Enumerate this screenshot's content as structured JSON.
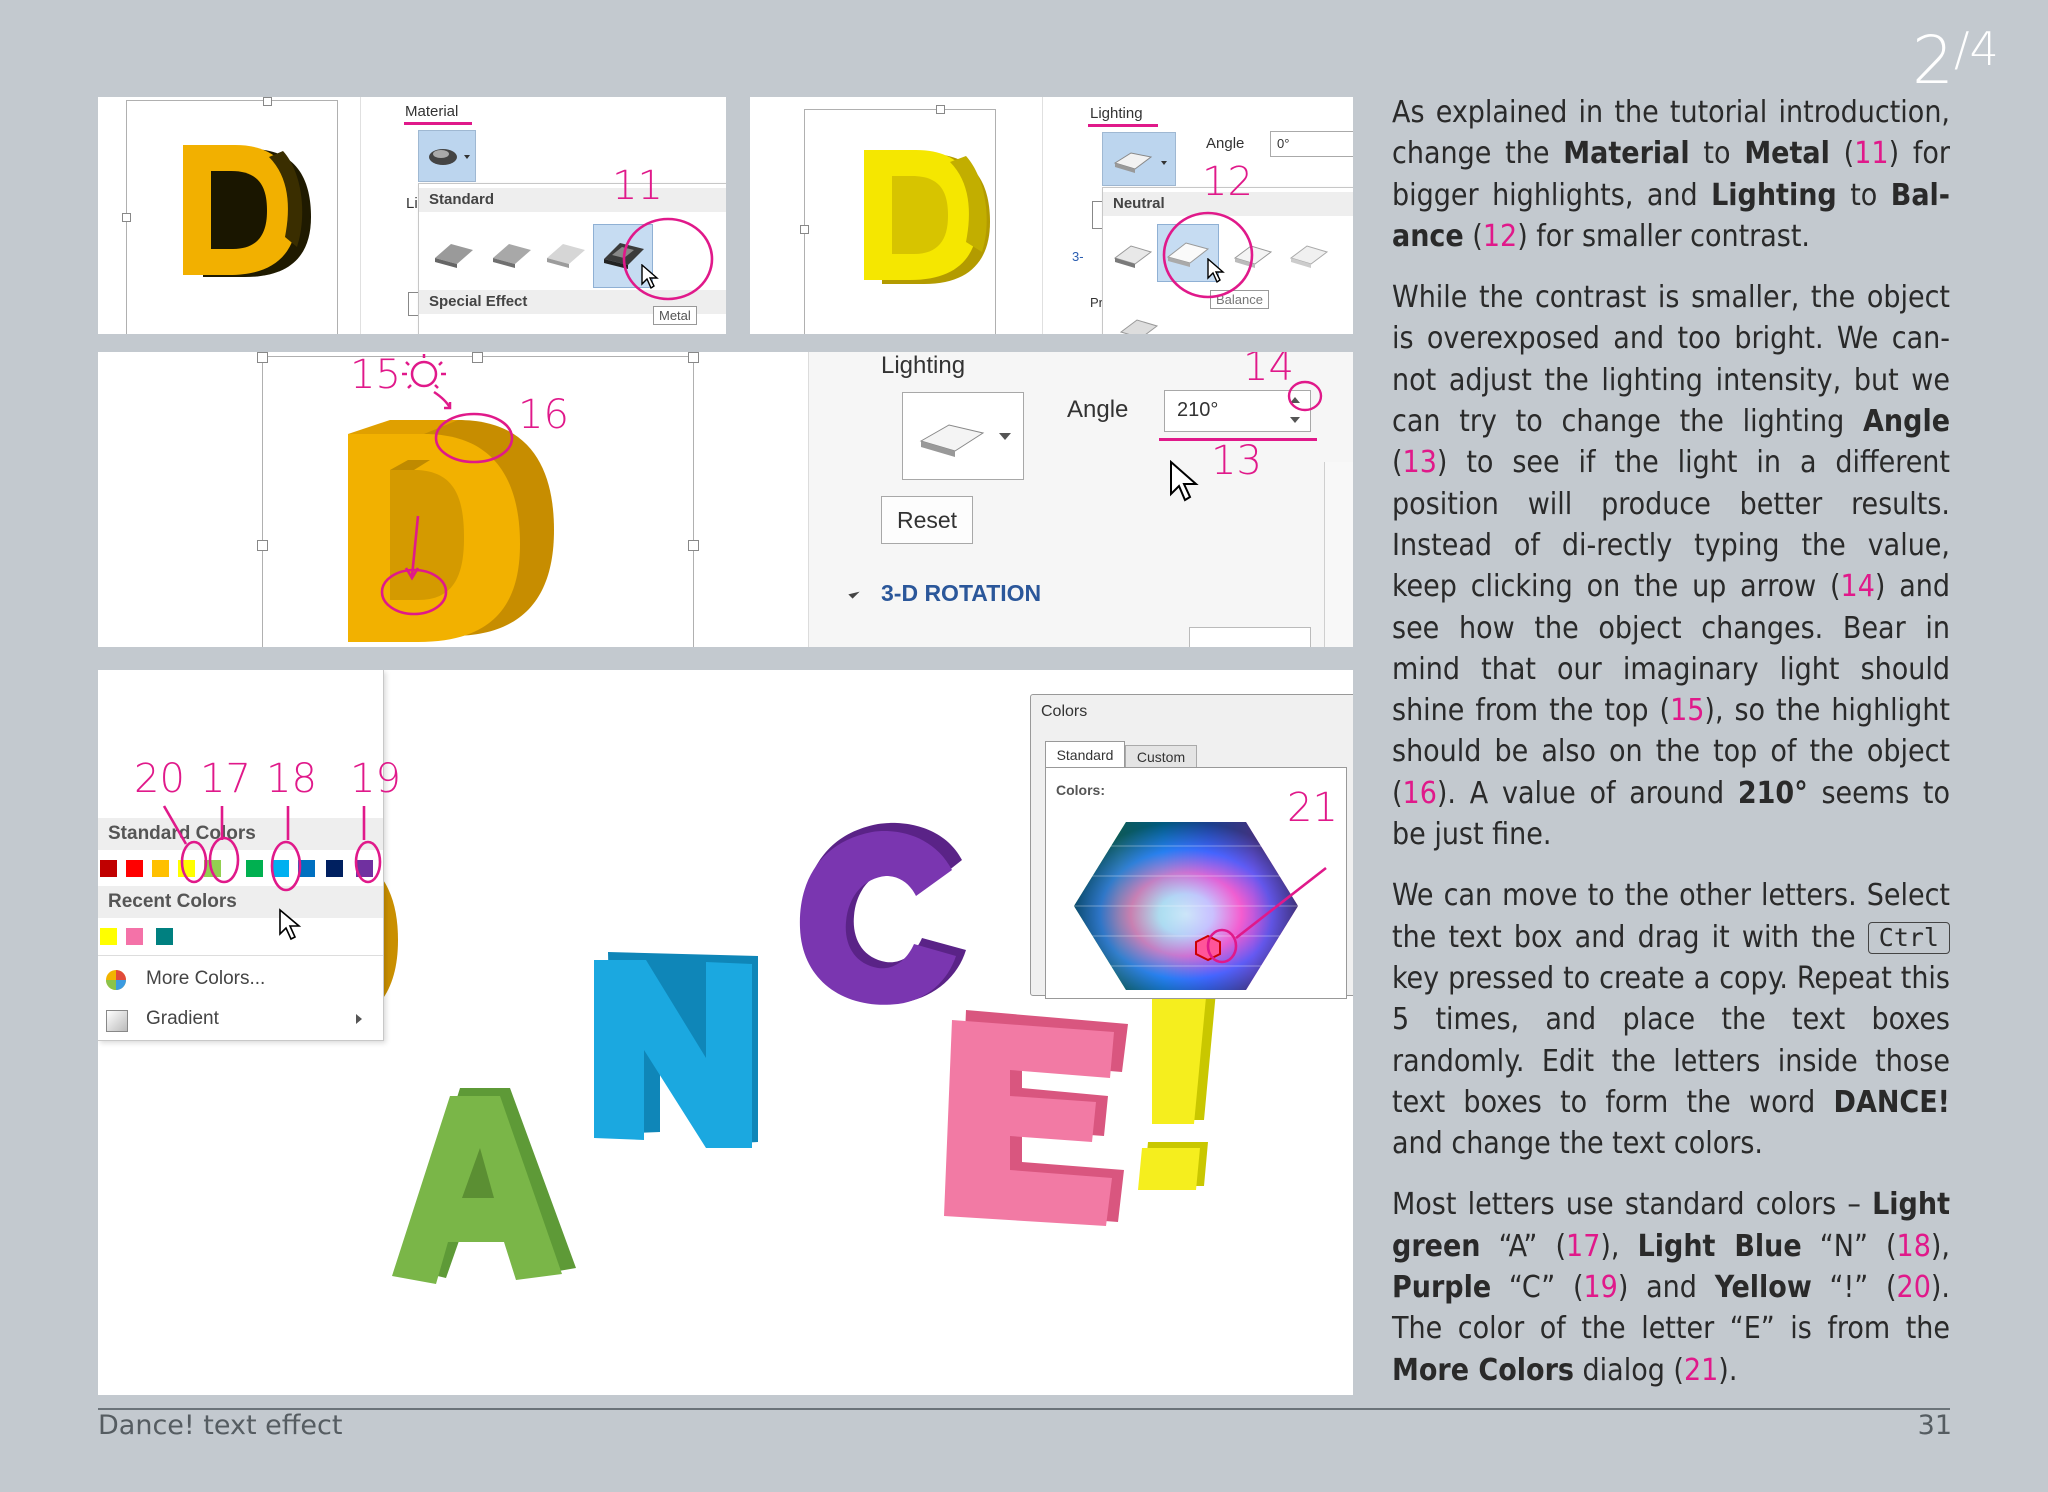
{
  "page_badge": {
    "current": "2",
    "total": "4"
  },
  "top_left": {
    "material_label": "Material",
    "lighting_abbrev": "Li",
    "standard_header": "Standard",
    "special_header": "Special Effect",
    "tooltip": "Metal",
    "callout": "11"
  },
  "top_right": {
    "lighting_label": "Lighting",
    "angle_label": "Angle",
    "angle_value": "0°",
    "neutral_header": "Neutral",
    "tooltip": "Balance",
    "callout": "12",
    "cut_3": "3-",
    "cut_pr": "Pr"
  },
  "middle": {
    "lighting_label": "Lighting",
    "angle_label": "Angle",
    "angle_value": "210°",
    "reset_label": "Reset",
    "rotation_label": "3-D ROTATION",
    "callout_13": "13",
    "callout_14": "14",
    "callout_15": "15",
    "callout_16": "16"
  },
  "bottom": {
    "standard_colors_label": "Standard Colors",
    "recent_colors_label": "Recent Colors",
    "more_colors_label": "More Colors...",
    "gradient_label": "Gradient",
    "dialog_title": "Colors",
    "tab_standard": "Standard",
    "tab_custom": "Custom",
    "colors_label": "Colors:",
    "standard_colors": [
      "#c00000",
      "#ff0000",
      "#ffc000",
      "#ffff00",
      "#92d050",
      "#00b050",
      "#00b0f0",
      "#0070c0",
      "#002060",
      "#7030a0"
    ],
    "recent_colors": [
      "#ffff00",
      "#f472a8",
      "#008080"
    ],
    "callout_17": "17",
    "callout_18": "18",
    "callout_19": "19",
    "callout_20": "20",
    "callout_21": "21",
    "letter_colors": {
      "D": "#f0b400",
      "A": "#74b547",
      "N": "#17a5df",
      "C": "#7030a0",
      "E": "#f07099",
      "!": "#f4ec1c"
    }
  },
  "text": {
    "p1": [
      {
        "t": "As explained in the tutorial introduction, change the "
      },
      {
        "t": "Material",
        "b": true
      },
      {
        "t": " to "
      },
      {
        "t": "Metal",
        "b": true
      },
      {
        "t": " ("
      },
      {
        "t": "11",
        "n": true
      },
      {
        "t": ") for bigger highlights, and "
      },
      {
        "t": "Lighting",
        "b": true
      },
      {
        "t": " to "
      },
      {
        "t": "Bal-ance",
        "b": true
      },
      {
        "t": " ("
      },
      {
        "t": "12",
        "n": true
      },
      {
        "t": ") for smaller contrast."
      }
    ],
    "p2": [
      {
        "t": "While the contrast is smaller, the object is overexposed and too bright. We can-not adjust the lighting intensity, but we can try to change the lighting "
      },
      {
        "t": "Angle",
        "b": true
      },
      {
        "t": " ("
      },
      {
        "t": "13",
        "n": true
      },
      {
        "t": ") to see if the light in a different position will produce better results. Instead of di-rectly typing the value, keep clicking on the up arrow ("
      },
      {
        "t": "14",
        "n": true
      },
      {
        "t": ") and see how the object changes. Bear in mind that our imaginary light should shine from the top ("
      },
      {
        "t": "15",
        "n": true
      },
      {
        "t": "), so the highlight should be also on the top of the object ("
      },
      {
        "t": "16",
        "n": true
      },
      {
        "t": "). A value of around "
      },
      {
        "t": "210°",
        "b": true
      },
      {
        "t": " seems to be just fine."
      }
    ],
    "p3": [
      {
        "t": "We can move to the other letters. Select the text box and drag it with the "
      },
      {
        "t": "Ctrl",
        "k": true
      },
      {
        "t": " key pressed to create a copy. Repeat this 5 times, and place the text boxes randomly. Edit the letters inside those text boxes to form the word "
      },
      {
        "t": "DANCE!",
        "b": true
      },
      {
        "t": " and change the text colors."
      }
    ],
    "p4": [
      {
        "t": "Most letters use standard colors – "
      },
      {
        "t": "Light green",
        "b": true
      },
      {
        "t": " “A” ("
      },
      {
        "t": "17",
        "n": true
      },
      {
        "t": "), "
      },
      {
        "t": "Light Blue",
        "b": true
      },
      {
        "t": " “N” ("
      },
      {
        "t": "18",
        "n": true
      },
      {
        "t": "), "
      },
      {
        "t": "Purple",
        "b": true
      },
      {
        "t": " “C” ("
      },
      {
        "t": "19",
        "n": true
      },
      {
        "t": ") and "
      },
      {
        "t": "Yellow",
        "b": true
      },
      {
        "t": " “!” ("
      },
      {
        "t": "20",
        "n": true
      },
      {
        "t": "). The color of the letter “E” is from the "
      },
      {
        "t": "More Colors",
        "b": true
      },
      {
        "t": " dialog ("
      },
      {
        "t": "21",
        "n": true
      },
      {
        "t": ")."
      }
    ]
  },
  "footer": {
    "title": "Dance! text effect",
    "page_number": "31"
  }
}
